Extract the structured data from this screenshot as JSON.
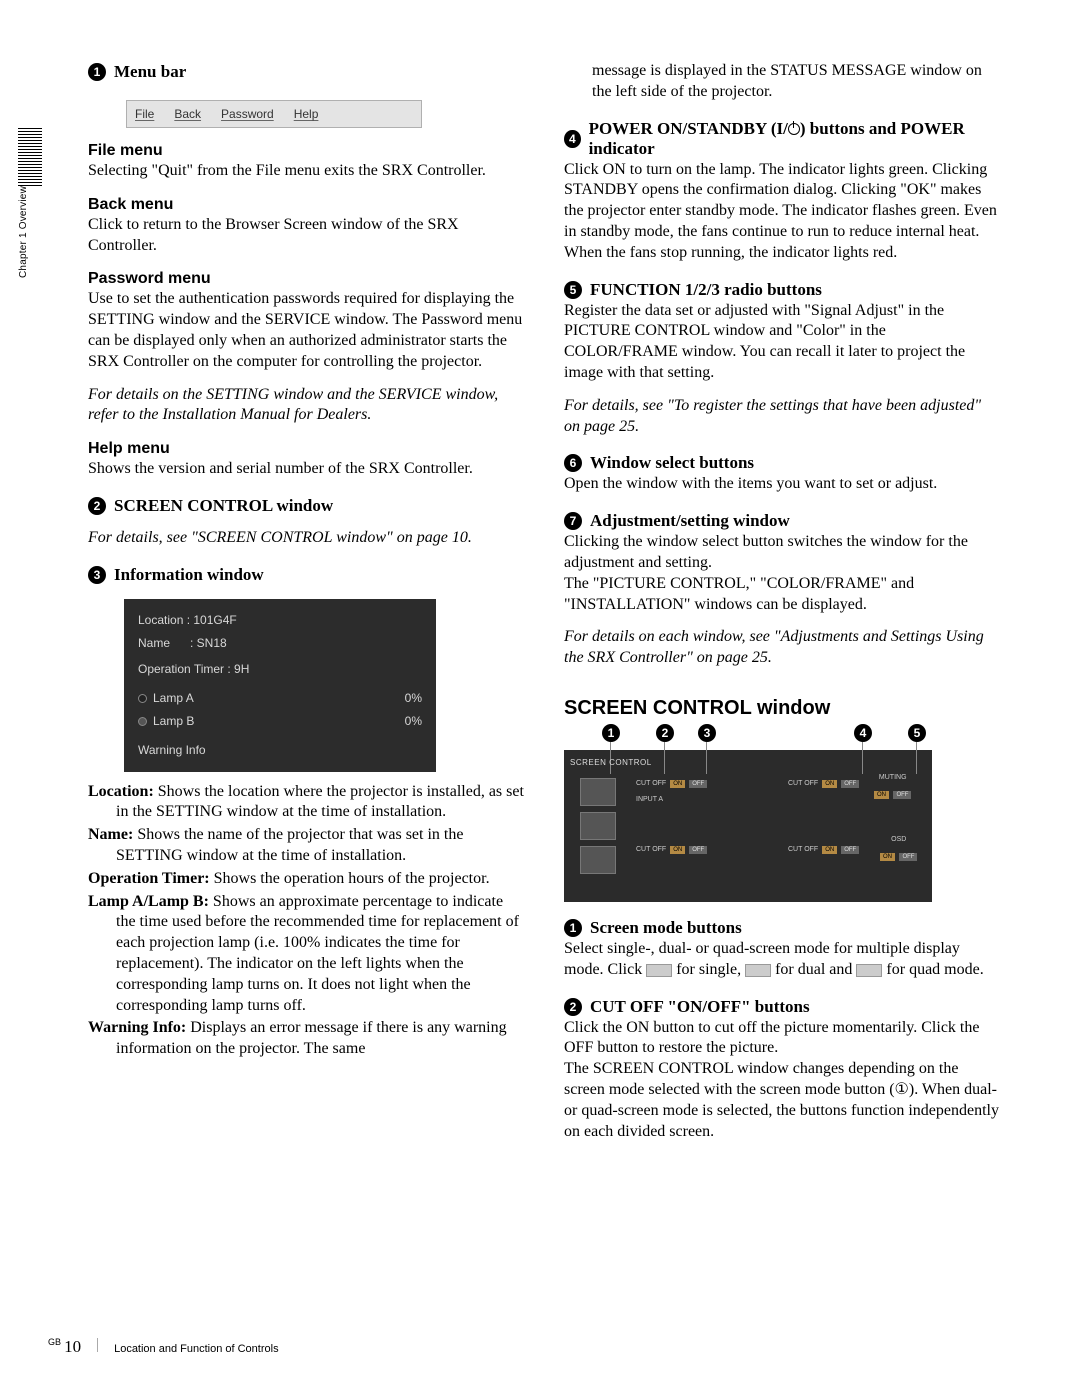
{
  "sideTab": {
    "label": "Chapter 1 Overview"
  },
  "left": {
    "c1": {
      "num": "1",
      "title": "Menu bar",
      "menuItems": {
        "file": "File",
        "back": "Back",
        "password": "Password",
        "help": "Help"
      },
      "file": {
        "head": "File menu",
        "body": "Selecting \"Quit\" from the File menu exits the SRX Controller."
      },
      "back": {
        "head": "Back menu",
        "body": "Click to return to the Browser Screen window of the SRX Controller."
      },
      "password": {
        "head": "Password menu",
        "body": "Use to set the authentication passwords required for displaying the SETTING window and the SERVICE window. The Password menu can be displayed only when an authorized administrator starts the SRX Controller on the computer for controlling the projector."
      },
      "passwordNote": "For details on the SETTING window and the SERVICE window, refer to the Installation Manual for Dealers.",
      "help": {
        "head": "Help menu",
        "body": "Shows the version and serial number of the SRX Controller."
      }
    },
    "c2": {
      "num": "2",
      "title": "SCREEN CONTROL window",
      "note": "For details, see \"SCREEN CONTROL window\" on page 10."
    },
    "c3": {
      "num": "3",
      "title": "Information window",
      "panel": {
        "location": "Location : 101G4F",
        "name": "Name      : SN18",
        "opTimer": "Operation Timer : 9H",
        "lampA": "Lamp A",
        "lampAval": "0%",
        "lampB": "Lamp B",
        "lampBval": "0%",
        "warn": "Warning Info"
      },
      "items": {
        "loc": {
          "lead": "Location:",
          "body": " Shows the location where the projector is installed, as set in the SETTING window at the time of installation."
        },
        "name": {
          "lead": "Name:",
          "body": " Shows the name of the projector that was set in the SETTING window at the time of installation."
        },
        "op": {
          "lead": "Operation Timer:",
          "body": " Shows the operation hours of the projector."
        },
        "lamp": {
          "lead": "Lamp A/Lamp B:",
          "body": " Shows an approximate percentage to indicate the time used before the recommended time for replacement of each projection lamp (i.e. 100% indicates the time for replacement). The indicator on the left lights when the corresponding lamp turns on. It does not light when the corresponding lamp turns off."
        },
        "warn": {
          "lead": "Warning Info:",
          "body": " Displays an error message if there is any warning information on the projector. The same"
        }
      }
    }
  },
  "right": {
    "cont": "message is displayed in the STATUS MESSAGE window on the left side of the projector.",
    "c4": {
      "num": "4",
      "titlePre": "POWER ON/STANDBY (",
      "titleMid": "I/",
      "titlePost": ") buttons and POWER indicator",
      "body": "Click ON to turn on the lamp. The indicator lights green. Clicking STANDBY opens the confirmation dialog. Clicking \"OK\" makes the projector enter standby mode. The indicator flashes green. Even in standby mode, the fans continue to run to reduce internal heat. When the fans stop running, the indicator lights red."
    },
    "c5": {
      "num": "5",
      "title": "FUNCTION 1/2/3 radio buttons",
      "body": "Register the data set or adjusted with \"Signal Adjust\" in the PICTURE CONTROL window and \"Color\" in the COLOR/FRAME window. You can recall it later to project the image with that setting.",
      "note": "For details, see \"To register the settings that have been adjusted\" on page 25."
    },
    "c6": {
      "num": "6",
      "title": "Window select buttons",
      "body": "Open the window with the items you want to set or adjust."
    },
    "c7": {
      "num": "7",
      "title": "Adjustment/setting window",
      "body": "Clicking the window select button switches the window for the adjustment and setting.\nThe \"PICTURE CONTROL,\" \"COLOR/FRAME\" and \"INSTALLATION\" windows can be displayed.",
      "note": "For details on each window, see \"Adjustments and Settings Using the SRX Controller\" on page 25."
    },
    "sc": {
      "heading": "SCREEN CONTROL window",
      "fig": {
        "title": "SCREEN CONTROL",
        "n1": "1",
        "n2": "2",
        "n3": "3",
        "n4": "4",
        "n5": "5",
        "cutoff": "CUT OFF",
        "on": "ON",
        "off": "OFF",
        "inputA": "INPUT A",
        "muting": "MUTING",
        "osd": "OSD"
      },
      "i1": {
        "num": "1",
        "title": "Screen mode buttons",
        "bodyA": "Select single-, dual- or quad-screen mode for multiple display mode. Click ",
        "bodyB": " for single, ",
        "bodyC": " for dual and ",
        "bodyD": " for quad mode."
      },
      "i2": {
        "num": "2",
        "title": "CUT OFF \"ON/OFF\" buttons",
        "body": "Click the ON button to cut off the picture momentarily. Click the OFF button to restore the picture.\nThe SCREEN CONTROL window changes depending on the screen mode selected with the screen mode button (①). When dual- or quad-screen mode is selected, the buttons function independently on each divided screen."
      }
    }
  },
  "footer": {
    "gb": "GB",
    "page": "10",
    "title": "Location and Function of Controls"
  }
}
